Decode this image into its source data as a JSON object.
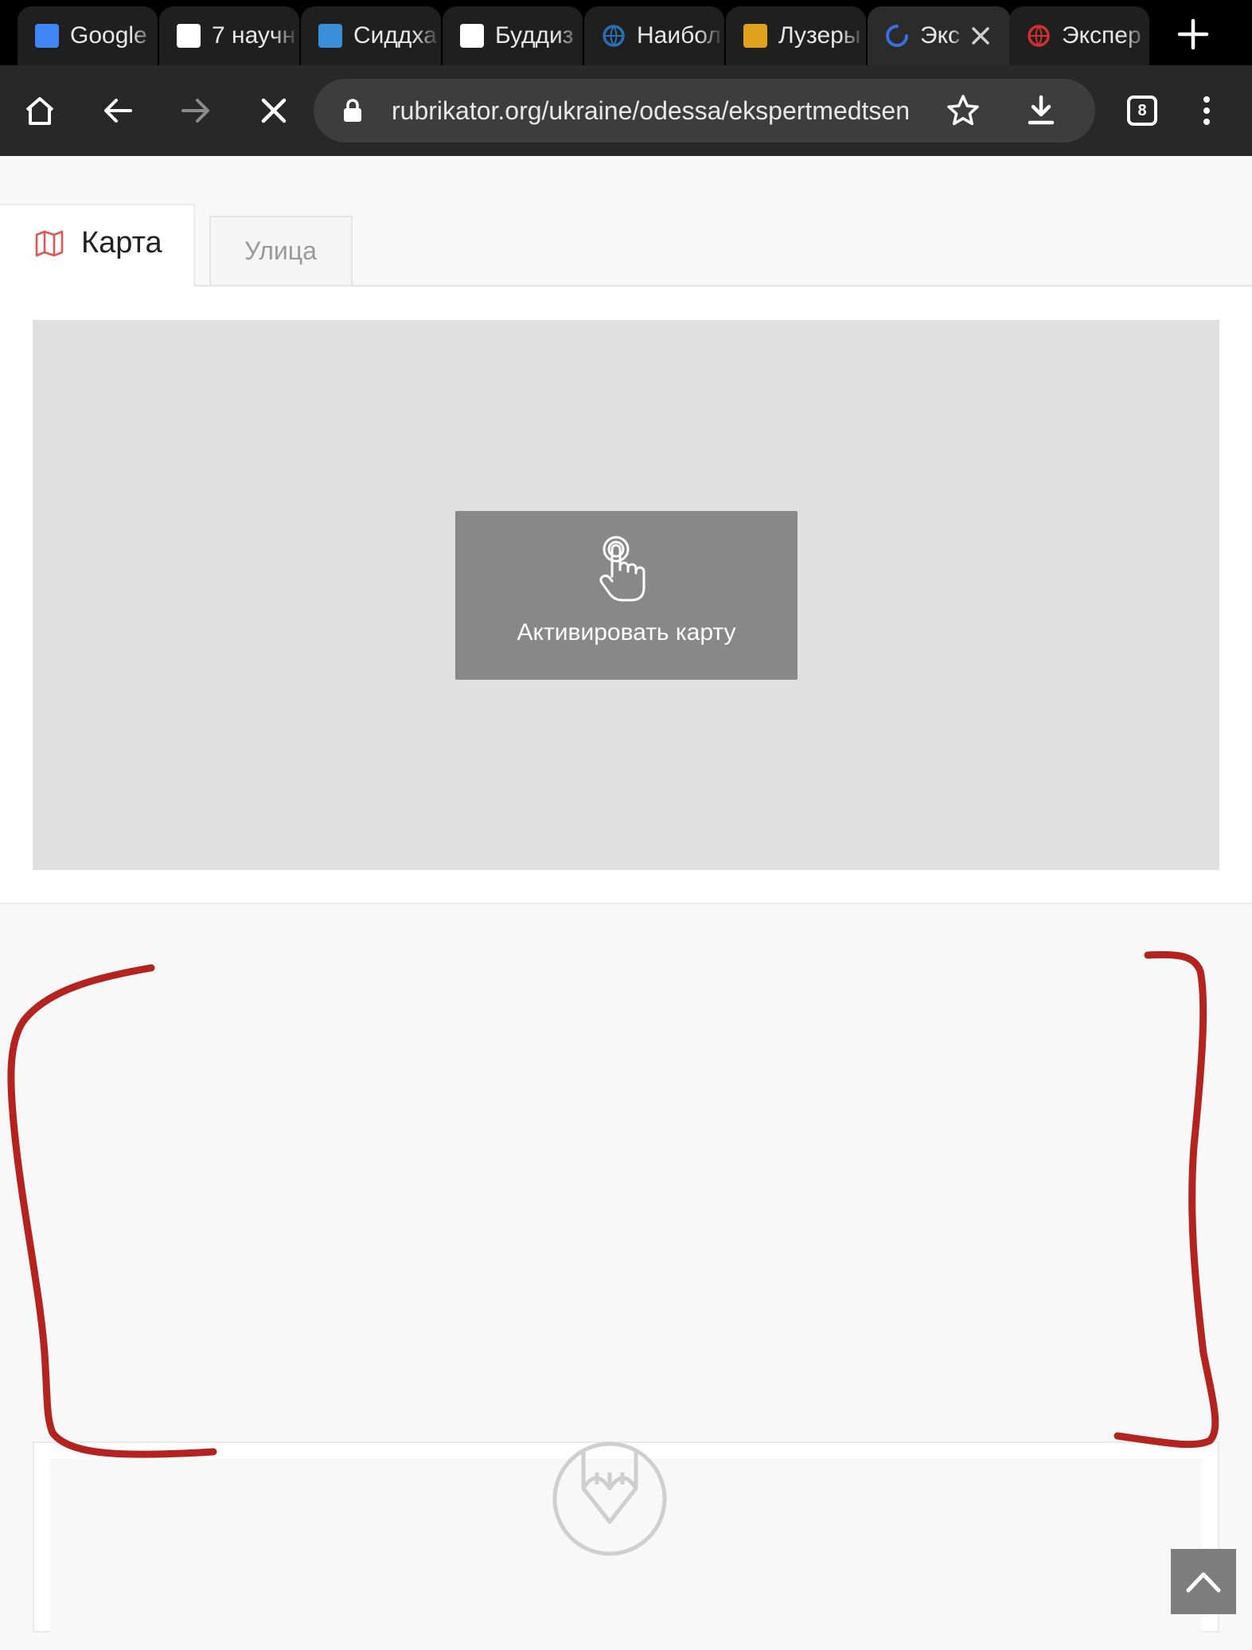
{
  "browser": {
    "tabs": [
      {
        "title": "Google",
        "favicon": "google-news-icon",
        "color": "#4285f4"
      },
      {
        "title": "7 научн",
        "favicon": "flipboard-icon",
        "color": "#ffffff"
      },
      {
        "title": "Сиддха",
        "favicon": "ts-icon",
        "color": "#3b8fd9"
      },
      {
        "title": "Буддиз",
        "favicon": "a-icon",
        "color": "#ffffff"
      },
      {
        "title": "Наибол",
        "favicon": "globe-people-icon",
        "color": "#2a6fb3"
      },
      {
        "title": "Лузеры",
        "favicon": "colorful-square-icon",
        "color": "#e0a21c"
      },
      {
        "title": "Экс",
        "favicon": "loading-spinner-icon",
        "color": "#3b6fe0",
        "active": true
      },
      {
        "title": "Экспер",
        "favicon": "red-globe-icon",
        "color": "#d03030"
      }
    ],
    "url": "rubrikator.org/ukraine/odessa/ekspertmedtsen",
    "tab_count": "8"
  },
  "page": {
    "tabs": {
      "map_label": "Карта",
      "street_label": "Улица"
    },
    "map": {
      "activate_label": "Активировать карту"
    }
  },
  "colors": {
    "annotation_red": "#b3231f",
    "map_icon_red": "#e05555"
  }
}
